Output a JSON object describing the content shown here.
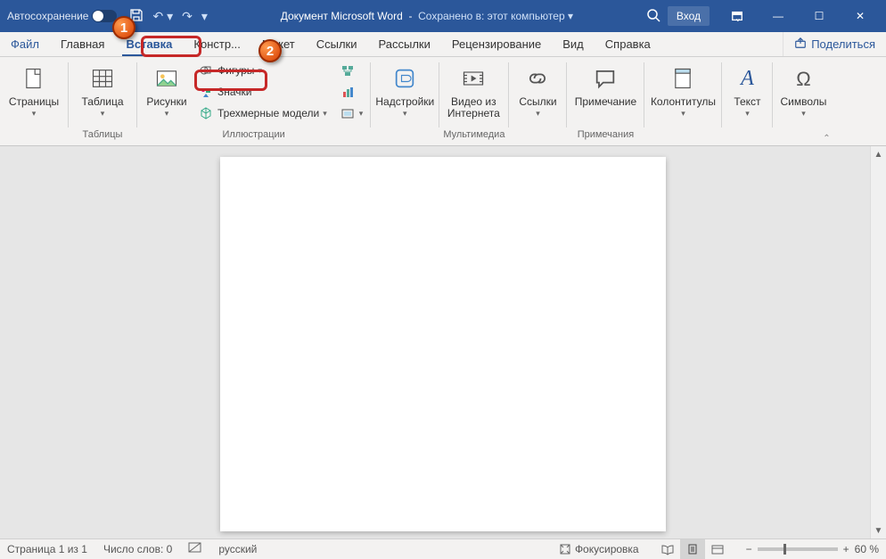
{
  "titlebar": {
    "autosave": "Автосохранение",
    "doc_title": "Документ Microsoft Word",
    "saved_to": "Сохранено в: этот компьютер",
    "login": "Вход"
  },
  "tabs": {
    "file": "Файл",
    "home": "Главная",
    "insert": "Вставка",
    "design": "Констр...",
    "layout": "Макет",
    "references": "Ссылки",
    "mailings": "Рассылки",
    "review": "Рецензирование",
    "view": "Вид",
    "help": "Справка",
    "share": "Поделиться"
  },
  "ribbon": {
    "pages": {
      "btn": "Страницы",
      "group": "",
      "single": ""
    },
    "tables": {
      "btn": "Таблица",
      "group": "Таблицы"
    },
    "illustrations": {
      "pictures": "Рисунки",
      "shapes": "Фигуры",
      "icons": "Значки",
      "models3d": "Трехмерные модели",
      "group": "Иллюстрации"
    },
    "addins": {
      "btn": "Надстройки"
    },
    "media": {
      "video": "Видео из\nИнтернета",
      "group": "Мультимедиа"
    },
    "links": {
      "btn": "Ссылки"
    },
    "comments": {
      "btn": "Примечание",
      "group": "Примечания"
    },
    "headerfooter": {
      "btn": "Колонтитулы"
    },
    "text": {
      "btn": "Текст"
    },
    "symbols": {
      "btn": "Символы"
    }
  },
  "statusbar": {
    "page": "Страница 1 из 1",
    "words": "Число слов: 0",
    "lang": "русский",
    "focus": "Фокусировка",
    "zoom": "60 %"
  },
  "callouts": {
    "one": "1",
    "two": "2"
  }
}
